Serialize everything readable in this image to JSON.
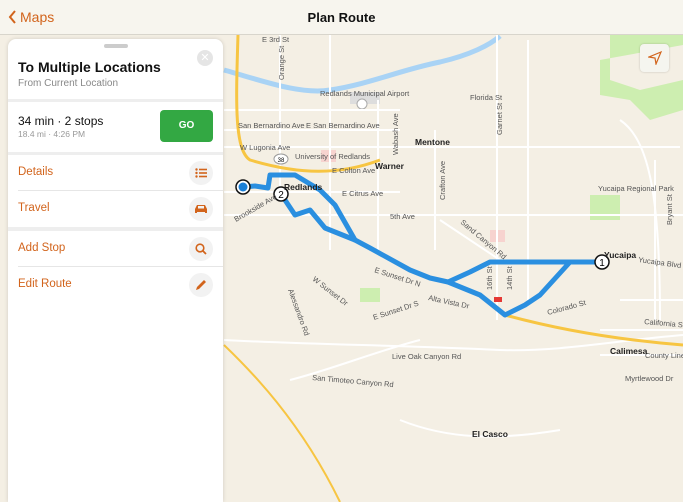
{
  "header": {
    "back_label": "Maps",
    "title": "Plan Route"
  },
  "panel": {
    "title": "To Multiple Locations",
    "subtitle": "From Current Location",
    "close_icon": "close-icon",
    "summary": {
      "duration_stops": "34 min · 2 stops",
      "distance_time": "18.4 mi · 4:26 PM"
    },
    "go_label": "GO",
    "rows": [
      {
        "label": "Details",
        "icon": "list-icon"
      },
      {
        "label": "Travel",
        "icon": "car-icon"
      },
      {
        "label": "Add Stop",
        "icon": "search-icon"
      },
      {
        "label": "Edit Route",
        "icon": "pencil-icon"
      }
    ]
  },
  "map": {
    "labels": [
      {
        "t": "E 3rd St"
      },
      {
        "t": "Redlands Municipal Airport"
      },
      {
        "t": "San Bernardino Ave"
      },
      {
        "t": "E San Bernardino Ave"
      },
      {
        "t": "W Lugonia Ave"
      },
      {
        "t": "University of Redlands"
      },
      {
        "t": "E Colton Ave"
      },
      {
        "t": "E Citrus Ave"
      },
      {
        "t": "5th Ave"
      },
      {
        "t": "Florida St"
      },
      {
        "t": "Garnet St"
      },
      {
        "t": "Wabash Ave"
      },
      {
        "t": "Crafton Ave"
      },
      {
        "t": "Sand Canyon Rd"
      },
      {
        "t": "Yucaipa Regional Park"
      },
      {
        "t": "Bryant St"
      },
      {
        "t": "Yucaipa Blvd"
      },
      {
        "t": "Colorado St"
      },
      {
        "t": "California St"
      },
      {
        "t": "County Line"
      },
      {
        "t": "Myrtlewood Dr"
      },
      {
        "t": "Live Oak Canyon Rd"
      },
      {
        "t": "San Timoteo Canyon Rd"
      },
      {
        "t": "E Sunset Dr N"
      },
      {
        "t": "Alta Vista Dr"
      },
      {
        "t": "E Sunset Dr S"
      },
      {
        "t": "W Sunset Dr"
      },
      {
        "t": "Brookside Ave"
      },
      {
        "t": "Alessandro Rd"
      },
      {
        "t": "16th St"
      },
      {
        "t": "14th St"
      },
      {
        "t": "Orange St"
      }
    ],
    "places": [
      {
        "t": "Mentone"
      },
      {
        "t": "Warner"
      },
      {
        "t": "Redlands"
      },
      {
        "t": "Yucaipa"
      },
      {
        "t": "Calimesa"
      },
      {
        "t": "El Casco"
      }
    ],
    "highway_shield": "38",
    "stops": [
      {
        "number": "1"
      },
      {
        "number": "2"
      }
    ],
    "route_color": "#2a8fe0",
    "accent": "#d2641c",
    "go_color": "#33a843"
  }
}
